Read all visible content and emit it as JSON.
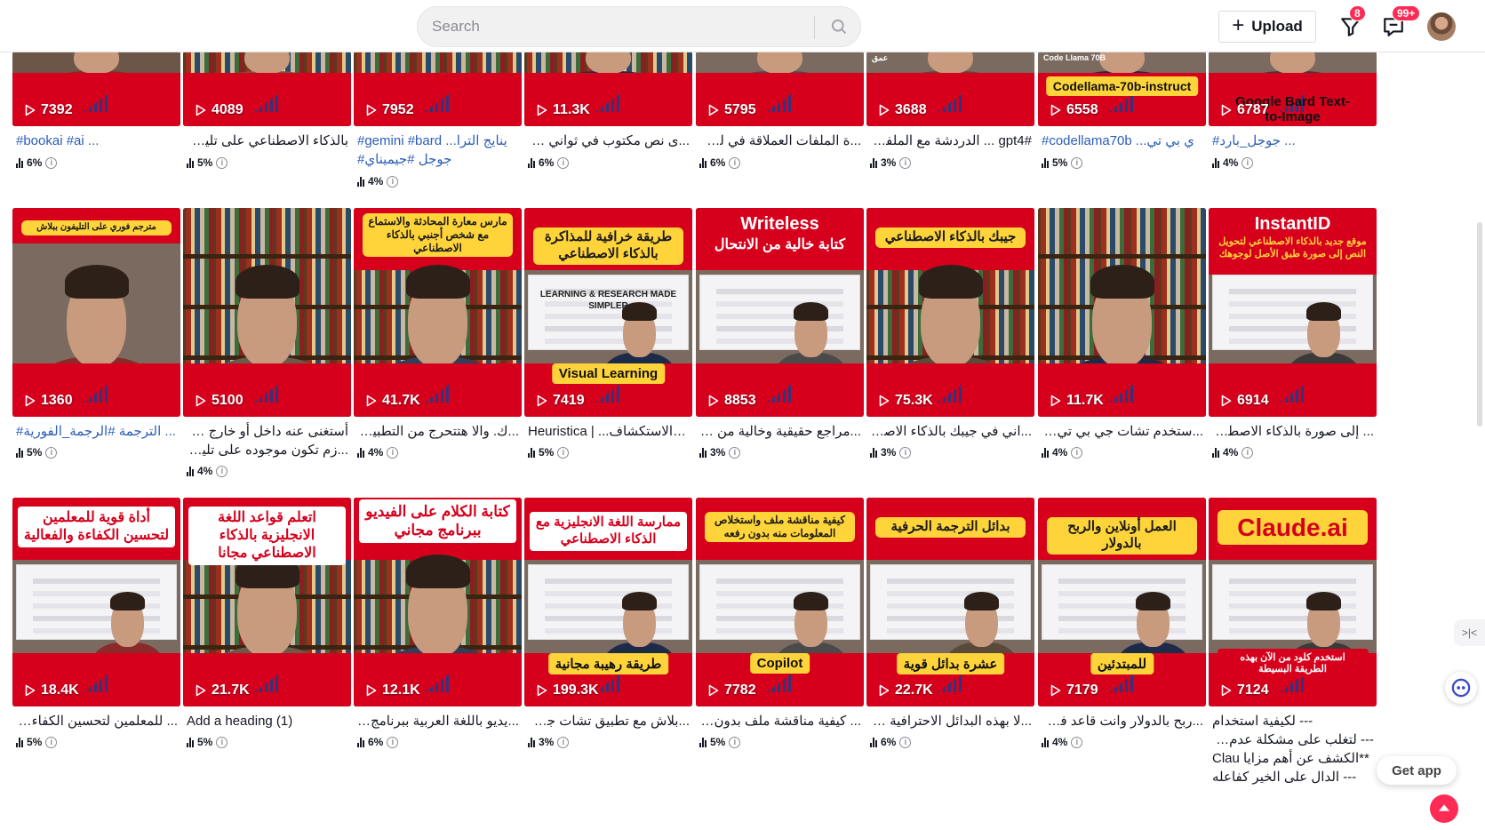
{
  "header": {
    "search_placeholder": "Search",
    "upload_label": "Upload",
    "filter_badge": "8",
    "inbox_badge": "99+",
    "icons": {
      "search": "search-icon",
      "filter": "filter-icon",
      "inbox": "message-icon",
      "plus": "plus-icon"
    }
  },
  "colors": {
    "brand_red": "#d6001c",
    "accent": "#fe2c55",
    "hashtag": "#2b5db9"
  },
  "videos": [
    {
      "views": "7392",
      "title": "#bookai #ai ...",
      "title_rtl": false,
      "pct": "6%"
    },
    {
      "views": "4089",
      "title": "بالذكاء الاصطناعي على تليفونك ...",
      "title_rtl": true,
      "pct": "5%"
    },
    {
      "views": "7952",
      "title": "#gemini #bard ...ينايج الترا",
      "title2": "#جوجل #جيميناي",
      "title_rtl": false,
      "pct": "4%"
    },
    {
      "views": "11.3K",
      "title": "...ى نص مكتوب في ثواني وببلاش",
      "title_rtl": true,
      "pct": "6%"
    },
    {
      "views": "5795",
      "title": "...ة الملفات العملاقة في لمح البصر",
      "title_rtl": true,
      "pct": "6%"
    },
    {
      "views": "3688",
      "title": "#gpt4 ... الدردشة مع الملفات",
      "title_rtl": true,
      "pct": "3%",
      "overlay": "عمق"
    },
    {
      "views": "6558",
      "title": "#codellama70b ...ي بي تي",
      "title_rtl": false,
      "pct": "5%",
      "chip": "Codellama-70b-instruct",
      "overlay": "Code Llama 70B"
    },
    {
      "views": "6787",
      "title": "#جوجل_بارد ...",
      "title_rtl": false,
      "pct": "4%",
      "chip": "Google Bard Text-to-Image"
    },
    {
      "views": "1360",
      "title": "#الترجمة #الرجمة_الفورية ...",
      "title_rtl": false,
      "pct": "5%",
      "headline": "مترجم فوري على التليفون ببلاش"
    },
    {
      "views": "5100",
      "title": "أستغنى عنه داخل أو خارج مصر...",
      "title2": "...زم تكون موجوده على تليفوناتا -",
      "title_rtl": true,
      "pct": "4%"
    },
    {
      "views": "41.7K",
      "title": "...ك. والا هتتحرج من التطبيق؟ --",
      "title_rtl": true,
      "pct": "4%",
      "headline": "مارس معارة المحادثة والاستماع مع شخص أجنبي بالذكاء الاصطناعي"
    },
    {
      "views": "7419",
      "title": "Heuristica | ...علم والاستكشاف",
      "title_rtl": false,
      "pct": "5%",
      "headline": "طريقة خرافية للمذاكرة بالذكاء الاصطناعي",
      "screen": "LEARNING & RESEARCH MADE SIMPLER",
      "chip": "Visual Learning"
    },
    {
      "views": "8853",
      "title": "...مراجع حقيقية وخالية من الانتحال",
      "title_rtl": true,
      "pct": "3%",
      "headline": "كتابة خالية من الانتحال",
      "headline_en": "Writeless"
    },
    {
      "views": "75.3K",
      "title": "...اني في جيبك بالذكاء الاصطناعي",
      "title_rtl": true,
      "pct": "3%",
      "headline": "جيبك بالذكاء الاصطناعي"
    },
    {
      "views": "11.7K",
      "title": "...ستخدم تشات جي بي تي ٤ ببلاش",
      "title_rtl": true,
      "pct": "4%"
    },
    {
      "views": "6914",
      "title": "... إلى صورة بالذكاء الاصطناعي",
      "title_rtl": true,
      "pct": "4%",
      "headline_en": "InstantID",
      "headline": "موقع جديد بالذكاء الاصطناعي لتحويل النص إلى صورة طبق الأصل لوجوهك"
    },
    {
      "views": "18.4K",
      "title": "... للمعلمين لتحسين الكفاءة والفعالية",
      "title_rtl": true,
      "pct": "5%",
      "headline": "أداة قوية للمعلمين لتحسين الكفاءة والفعالية"
    },
    {
      "views": "21.7K",
      "title": "Add a heading (1)",
      "title_rtl": false,
      "pct": "5%",
      "headline": "اتعلم قواعد اللغة الانجليزية بالذكاء الاصطناعي مجانا"
    },
    {
      "views": "12.1K",
      "title": "...يديو باللغة العربية ببرنامج مجاني",
      "title_rtl": true,
      "pct": "6%",
      "headline": "كتابة الكلام على الفيديو ببرنامج مجاني"
    },
    {
      "views": "199.3K",
      "title": "...بلاش مع تطبيق تشات جي بي تي",
      "title_rtl": true,
      "pct": "3%",
      "headline": "ممارسة اللغة الانجليزية مع الذكاء الاصطناعي",
      "chip": "طريقة رهيبة مجانية"
    },
    {
      "views": "7782",
      "title": "... كيفية مناقشة ملف بدون رفعه",
      "title_rtl": true,
      "pct": "5%",
      "headline": "كيفية مناقشة ملف واستخلاص المعلومات منه بدون رفعه",
      "chip": "Copilot"
    },
    {
      "views": "22.7K",
      "title": "...لا بهذه البدائل الاحترافية المجانية",
      "title_rtl": true,
      "pct": "6%",
      "headline": "بدائل الترجمة الحرفية",
      "chip": "عشرة بدائل قوية"
    },
    {
      "views": "7179",
      "title": "...ربح بالدولار وانت قاعد في بيتكم",
      "title_rtl": true,
      "pct": "4%",
      "headline": "العمل أونلاين والربح بالدولار",
      "chip": "للمبتدئين"
    },
    {
      "views": "7124",
      "title": "--- لكيفية استخدام",
      "title2": "--- لتغلب على مشكلة عدم إتاحة",
      "title3": "**الكشف عن أهم مزايا Clau",
      "title4": "--- الدال على الخير كفاعله",
      "title_rtl": true,
      "pct": "",
      "headline_en": "Claude.ai",
      "chip": "استخدم كلود من الآن بهذه الطريقة البسيطة"
    }
  ],
  "floating": {
    "get_app_label": "Get app",
    "side_tab_label": ">|<"
  }
}
